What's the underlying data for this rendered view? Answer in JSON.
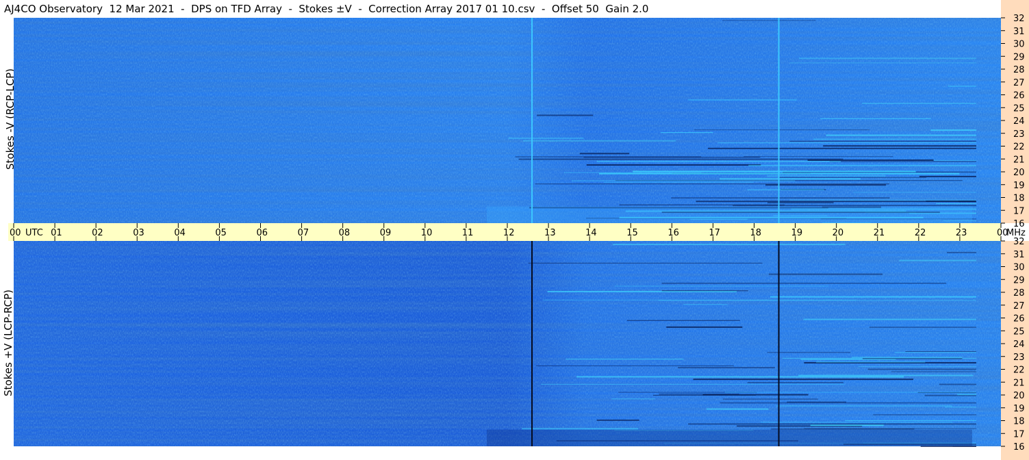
{
  "title": "AJ4CO Observatory  12 Mar 2021  -  DPS on TFD Array  -  Stokes ±V  -  Correction Array 2017 01 10.csv  -  Offset 50  Gain 2.0",
  "panels": [
    {
      "ylabel": "Stokes -V (RCP-LCP)"
    },
    {
      "ylabel": "Stokes +V (LCP-RCP)"
    }
  ],
  "colors": {
    "background_blue": "#1e6fe8",
    "bright_cyan": "#3fd8ff",
    "dark_navy": "#08205a",
    "time_axis_band": "#ffffc4",
    "freq_axis_band": "#ffdcbc"
  },
  "chart_data": [
    {
      "type": "heatmap",
      "title": "",
      "panel": "Stokes -V (RCP-LCP)",
      "xlabel": "UTC",
      "ylabel": "MHz",
      "x_ticks": [
        "00",
        "01",
        "02",
        "03",
        "04",
        "05",
        "06",
        "07",
        "08",
        "09",
        "10",
        "11",
        "12",
        "13",
        "14",
        "15",
        "16",
        "17",
        "18",
        "19",
        "20",
        "21",
        "22",
        "23",
        "00"
      ],
      "xlim": [
        0,
        24
      ],
      "y_ticks": [
        16,
        17,
        18,
        19,
        20,
        21,
        22,
        23,
        24,
        25,
        26,
        27,
        28,
        29,
        30,
        31,
        32
      ],
      "ylim": [
        16,
        32
      ],
      "vertical_lines_utc": [
        12.6,
        18.6
      ]
    },
    {
      "type": "heatmap",
      "title": "",
      "panel": "Stokes +V (LCP-RCP)",
      "xlabel": "UTC",
      "ylabel": "MHz",
      "x_ticks": [
        "00",
        "01",
        "02",
        "03",
        "04",
        "05",
        "06",
        "07",
        "08",
        "09",
        "10",
        "11",
        "12",
        "13",
        "14",
        "15",
        "16",
        "17",
        "18",
        "19",
        "20",
        "21",
        "22",
        "23",
        "00"
      ],
      "xlim": [
        0,
        24
      ],
      "y_ticks": [
        16,
        17,
        18,
        19,
        20,
        21,
        22,
        23,
        24,
        25,
        26,
        27,
        28,
        29,
        30,
        31,
        32
      ],
      "ylim": [
        16,
        32
      ],
      "vertical_lines_utc": [
        12.6,
        18.6
      ]
    }
  ],
  "axis_text": {
    "utc": "UTC",
    "mhz": "MHz"
  }
}
